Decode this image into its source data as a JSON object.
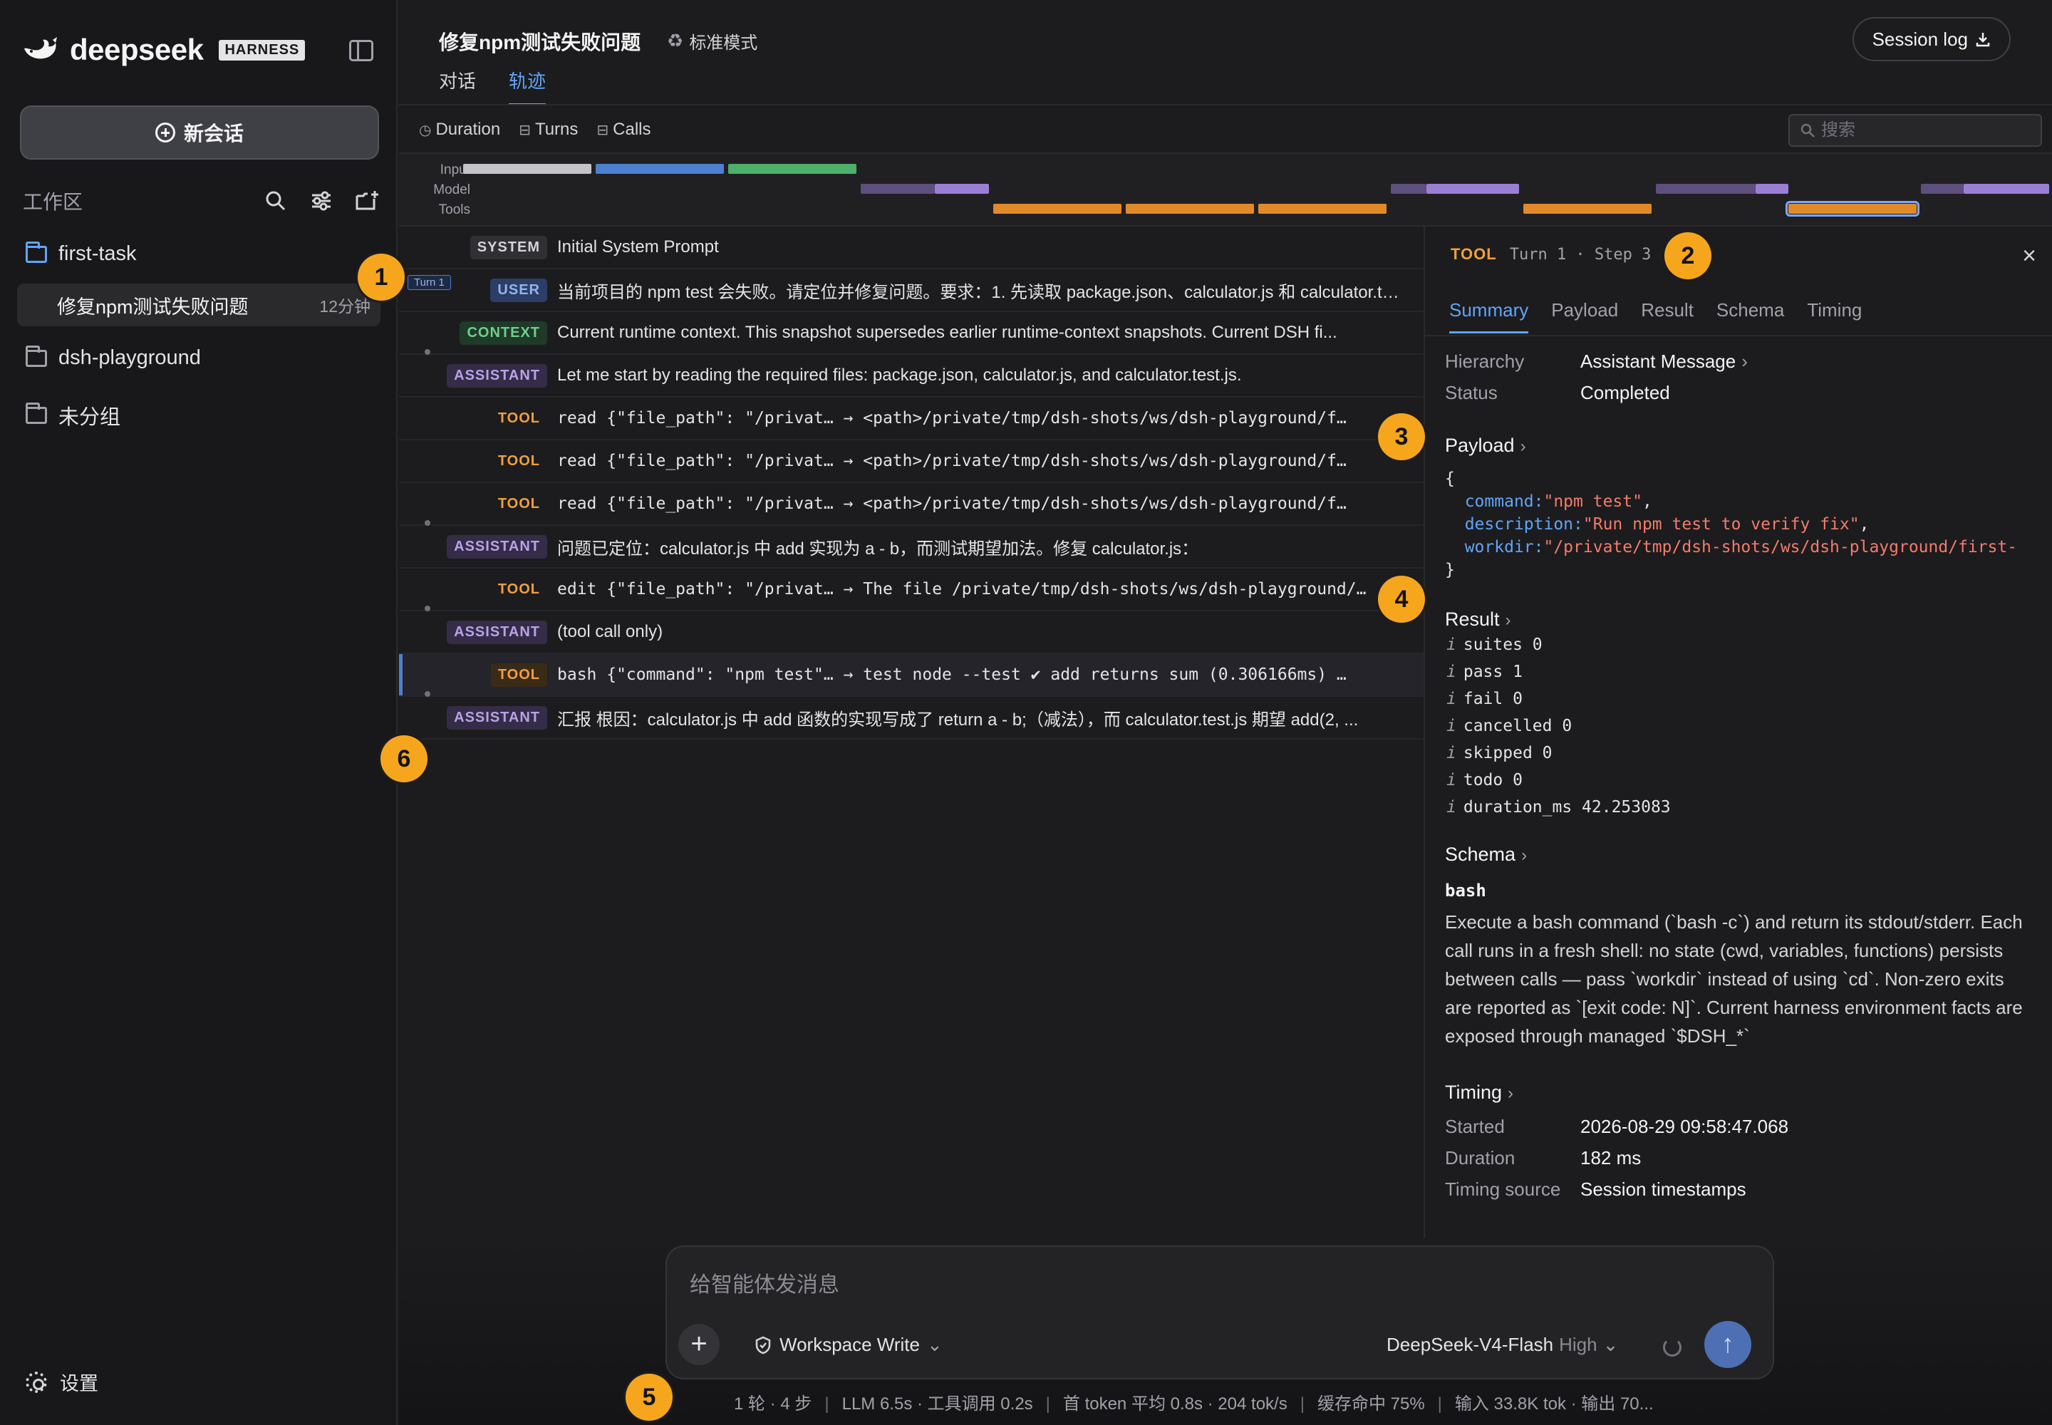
{
  "sidebar": {
    "brand_name": "deepseek",
    "brand_badge": "HARNESS",
    "new_chat_label": "新会话",
    "workspace_label": "工作区",
    "folders": [
      {
        "name": "first-task",
        "open": true
      },
      {
        "name": "dsh-playground",
        "open": false
      },
      {
        "name": "未分组",
        "open": false
      }
    ],
    "active_session": {
      "title": "修复npm测试失败问题",
      "ago": "12分钟"
    },
    "settings_label": "设置"
  },
  "header": {
    "title": "修复npm测试失败问题",
    "mode": "标准模式",
    "tabs": [
      {
        "label": "对话",
        "active": false
      },
      {
        "label": "轨迹",
        "active": true
      }
    ],
    "session_log_label": "Session log"
  },
  "filters": {
    "duration": "Duration",
    "turns": "Turns",
    "calls": "Calls",
    "search_placeholder": "搜索"
  },
  "timeline": {
    "lanes": [
      "Input",
      "Model",
      "Tools"
    ]
  },
  "events": [
    {
      "kind": "SYSTEM",
      "text": "Initial System Prompt",
      "mono": false
    },
    {
      "kind": "USER",
      "turn_tag": "Turn 1",
      "text": "当前项目的 npm test 会失败。请定位并修复问题。要求：1. 先读取 package.json、calculator.js 和 calculator.test.js...",
      "mono": false
    },
    {
      "kind": "CONTEXT",
      "text": "Current runtime context. This snapshot supersedes earlier runtime-context snapshots. Current DSH fi...",
      "mono": false
    },
    {
      "kind": "ASSISTANT",
      "text": "Let me start by reading the required files: package.json, calculator.js, and calculator.test.js.",
      "mono": false
    },
    {
      "kind": "TOOL",
      "text": "read {\"file_path\": \"/privat… → <path>/private/tmp/dsh-shots/ws/dsh-playground/f…",
      "mono": true
    },
    {
      "kind": "TOOL",
      "text": "read {\"file_path\": \"/privat… → <path>/private/tmp/dsh-shots/ws/dsh-playground/f…",
      "mono": true
    },
    {
      "kind": "TOOL",
      "text": "read {\"file_path\": \"/privat… → <path>/private/tmp/dsh-shots/ws/dsh-playground/f…",
      "mono": true
    },
    {
      "kind": "ASSISTANT",
      "text": "问题已定位：calculator.js 中 add 实现为 a - b，而测试期望加法。修复 calculator.js：",
      "mono": false
    },
    {
      "kind": "TOOL",
      "text": "edit {\"file_path\": \"/privat… → The file /private/tmp/dsh-shots/ws/dsh-playground/…",
      "mono": true
    },
    {
      "kind": "ASSISTANT",
      "text": "(tool call only)",
      "mono": false
    },
    {
      "kind": "TOOL",
      "text": "bash {\"command\": \"npm test\"… → test node --test ✔ add returns sum (0.306166ms) …",
      "mono": true,
      "selected": true
    },
    {
      "kind": "ASSISTANT",
      "text": "汇报 根因：calculator.js 中 add 函数的实现写成了 return a - b;（减法），而 calculator.test.js 期望 add(2, ...",
      "mono": false
    }
  ],
  "detail": {
    "kind": "TOOL",
    "step": "Turn 1 · Step 3",
    "close": "×",
    "tabs": [
      "Summary",
      "Payload",
      "Result",
      "Schema",
      "Timing"
    ],
    "active_tab": "Summary",
    "summary": {
      "hierarchy_label": "Hierarchy",
      "hierarchy_value": "Assistant Message",
      "status_label": "Status",
      "status_value": "Completed"
    },
    "payload_title": "Payload",
    "payload": {
      "command_key": "command:",
      "command_val": "\"npm test\"",
      "description_key": "description:",
      "description_val": "\"Run npm test to verify fix\"",
      "workdir_key": "workdir:",
      "workdir_val": "\"/private/tmp/dsh-shots/ws/dsh-playground/first-"
    },
    "result_title": "Result",
    "result_lines": [
      "suites 0",
      "pass 1",
      "fail 0",
      "cancelled 0",
      "skipped 0",
      "todo 0",
      "duration_ms 42.253083"
    ],
    "schema_title": "Schema",
    "schema_name": "bash",
    "schema_desc": "Execute a bash command (`bash -c`) and return its stdout/stderr. Each call runs in a fresh shell: no state (cwd, variables, functions) persists between calls — pass `workdir` instead of using `cd`. Non-zero exits are reported as `[exit code: N]`. Current harness environment facts are exposed through managed `$DSH_*`",
    "timing_title": "Timing",
    "timing": [
      {
        "k": "Started",
        "v": "2026-08-29 09:58:47.068"
      },
      {
        "k": "Duration",
        "v": "182 ms"
      },
      {
        "k": "Timing source",
        "v": "Session timestamps"
      }
    ]
  },
  "composer": {
    "placeholder": "给智能体发消息",
    "permission": "Workspace Write",
    "model": "DeepSeek-V4-Flash",
    "effort": "High"
  },
  "status": {
    "parts": [
      "1 轮 · 4 步",
      "LLM 6.5s · 工具调用 0.2s",
      "首 token 平均 0.8s · 204 tok/s",
      "缓存命中 75%",
      "输入 33.8K tok · 输出 70..."
    ]
  },
  "markers": [
    "1",
    "2",
    "3",
    "4",
    "5",
    "6"
  ],
  "colors": {
    "accent": "#60a5fa",
    "tool": "#f0a040",
    "assistant": "#b9a2e8",
    "context": "#6fcf8a",
    "marker": "#f6a61d"
  }
}
